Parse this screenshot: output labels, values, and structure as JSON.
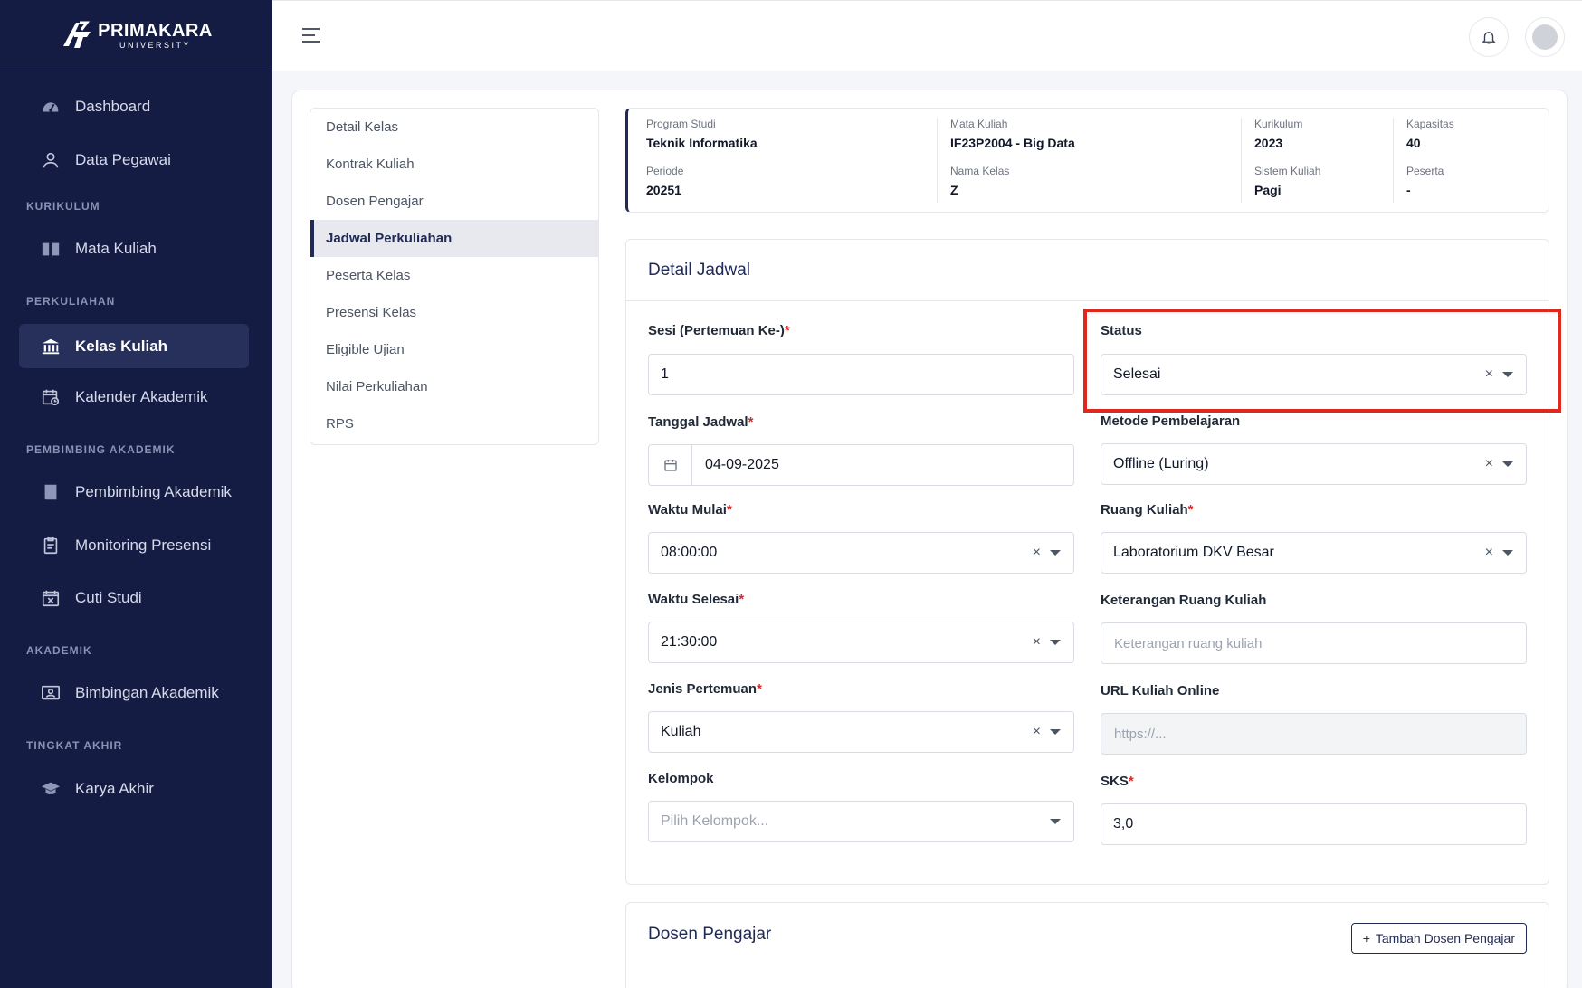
{
  "brand": {
    "name": "PRIMAKARA",
    "sub": "UNIVERSITY"
  },
  "sidebar": {
    "items": [
      {
        "label": "Dashboard",
        "icon": "dashboard-icon"
      },
      {
        "label": "Data Pegawai",
        "icon": "user-icon"
      },
      {
        "section": "KURIKULUM"
      },
      {
        "label": "Mata Kuliah",
        "icon": "book-open-icon"
      },
      {
        "section": "PERKULIAHAN"
      },
      {
        "label": "Kelas Kuliah",
        "icon": "building-icon",
        "active": true
      },
      {
        "label": "Kalender Akademik",
        "icon": "calendar-clock-icon"
      },
      {
        "section": "PEMBIMBING AKADEMIK"
      },
      {
        "label": "Pembimbing Akademik",
        "icon": "book-icon"
      },
      {
        "label": "Monitoring Presensi",
        "icon": "clipboard-icon"
      },
      {
        "label": "Cuti Studi",
        "icon": "calendar-x-icon"
      },
      {
        "section": "AKADEMIK"
      },
      {
        "label": "Bimbingan Akademik",
        "icon": "presentation-icon"
      },
      {
        "section": "TINGKAT AKHIR"
      },
      {
        "label": "Karya Akhir",
        "icon": "graduation-cap-icon"
      }
    ]
  },
  "submenu": [
    "Detail Kelas",
    "Kontrak Kuliah",
    "Dosen Pengajar",
    "Jadwal Perkuliahan",
    "Peserta Kelas",
    "Presensi Kelas",
    "Eligible Ujian",
    "Nilai Perkuliahan",
    "RPS"
  ],
  "info": {
    "program_studi": {
      "label": "Program Studi",
      "value": "Teknik Informatika"
    },
    "mata_kuliah": {
      "label": "Mata Kuliah",
      "value": "IF23P2004 - Big Data"
    },
    "kurikulum": {
      "label": "Kurikulum",
      "value": "2023"
    },
    "kapasitas": {
      "label": "Kapasitas",
      "value": "40"
    },
    "periode": {
      "label": "Periode",
      "value": "20251"
    },
    "nama_kelas": {
      "label": "Nama Kelas",
      "value": "Z"
    },
    "sistem_kuliah": {
      "label": "Sistem Kuliah",
      "value": "Pagi"
    },
    "peserta": {
      "label": "Peserta",
      "value": "-"
    }
  },
  "form": {
    "title": "Detail Jadwal",
    "sesi": {
      "label": "Sesi (Pertemuan Ke-)",
      "value": "1"
    },
    "status": {
      "label": "Status",
      "value": "Selesai"
    },
    "tanggal": {
      "label": "Tanggal Jadwal",
      "value": "04-09-2025"
    },
    "metode": {
      "label": "Metode Pembelajaran",
      "value": "Offline (Luring)"
    },
    "waktu_mulai": {
      "label": "Waktu Mulai",
      "value": "08:00:00"
    },
    "ruang": {
      "label": "Ruang Kuliah",
      "value": "Laboratorium DKV Besar"
    },
    "waktu_selesai": {
      "label": "Waktu Selesai",
      "value": "21:30:00"
    },
    "ket_ruang": {
      "label": "Keterangan Ruang Kuliah",
      "placeholder": "Keterangan ruang kuliah"
    },
    "jenis": {
      "label": "Jenis Pertemuan",
      "value": "Kuliah"
    },
    "url": {
      "label": "URL Kuliah Online",
      "placeholder": "https://..."
    },
    "kelompok": {
      "label": "Kelompok",
      "placeholder": "Pilih Kelompok..."
    },
    "sks": {
      "label": "SKS",
      "value": "3,0"
    },
    "req": "*",
    "clear": "×"
  },
  "dosen": {
    "title": "Dosen Pengajar",
    "add_label": "Tambah Dosen Pengajar",
    "add_icon": "+"
  },
  "colors": {
    "sidebar_bg": "#141c43",
    "accent": "#1f2a55",
    "highlight": "#e0281f",
    "required": "#dc2626"
  }
}
